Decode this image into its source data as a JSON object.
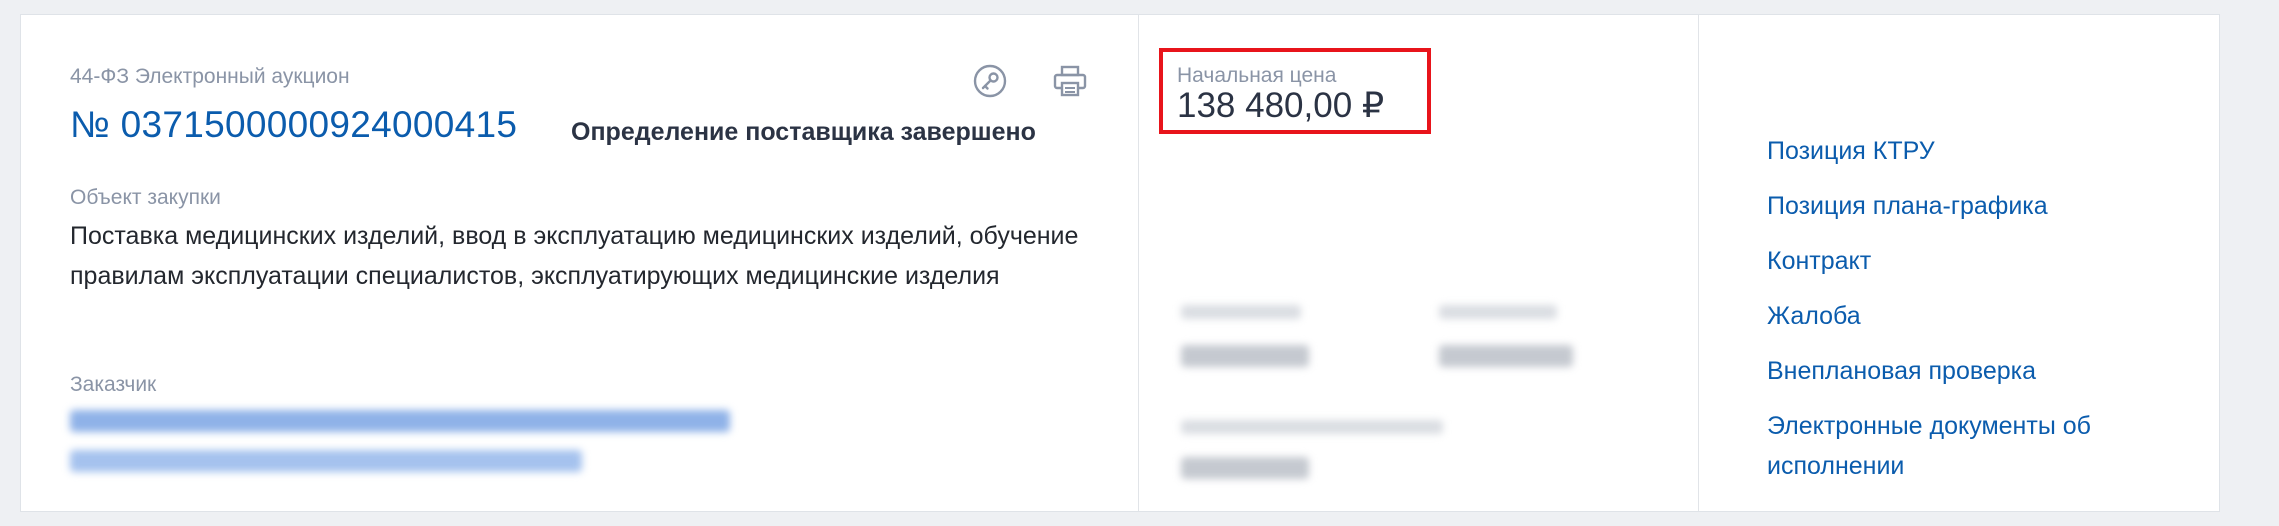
{
  "purchase": {
    "law_type": "44-ФЗ Электронный аукцион",
    "number": "№ 0371500000924000415",
    "status": "Определение поставщика завершено",
    "object_label": "Объект закупки",
    "object_text": "Поставка медицинских изделий, ввод в эксплуатацию медицинских изделий, обучение правилам эксплуатации специалистов, эксплуатирующих медицинские изделия",
    "customer_label": "Заказчик"
  },
  "icons": {
    "key": "key-icon",
    "print": "printer-icon"
  },
  "price": {
    "label": "Начальная цена",
    "value": "138 480,00 ₽",
    "highlight_color": "#e8141b"
  },
  "links": [
    "Позиция КТРУ",
    "Позиция плана-графика",
    "Контракт",
    "Жалоба",
    "Внеплановая проверка",
    "Электронные документы об исполнении"
  ],
  "colors": {
    "accent": "#0b5cad",
    "text": "#23272e",
    "muted": "#8a94a6"
  }
}
